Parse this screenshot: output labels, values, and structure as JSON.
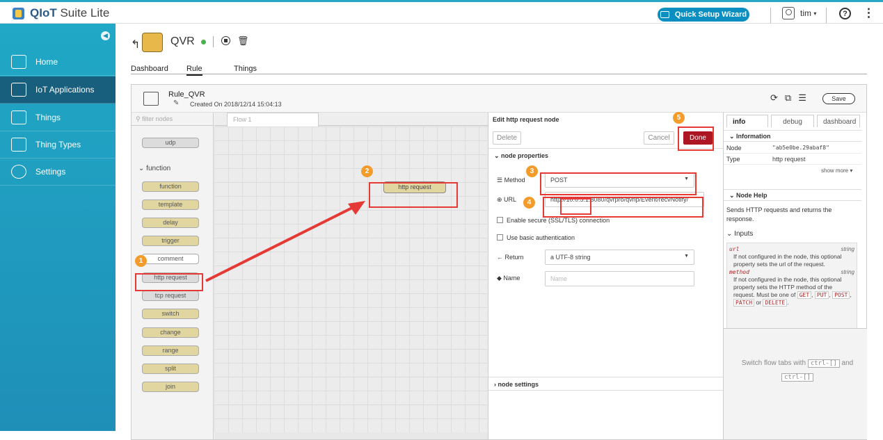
{
  "app": {
    "brand_bold": "QIoT",
    "brand_rest": " Suite Lite"
  },
  "topbar": {
    "quick_setup": "Quick Setup Wizard",
    "user": "tim",
    "user_caret": "▾",
    "help": "?",
    "more": "⋮"
  },
  "sidebar": {
    "items": [
      {
        "label": "Home",
        "icon": "home-icon"
      },
      {
        "label": "IoT Applications",
        "icon": "iot-app-icon"
      },
      {
        "label": "Things",
        "icon": "chip-icon"
      },
      {
        "label": "Thing Types",
        "icon": "grid-icon"
      },
      {
        "label": "Settings",
        "icon": "gear-icon"
      }
    ]
  },
  "header": {
    "title": "QVR"
  },
  "tabs": [
    "Dashboard",
    "Rule",
    "Things"
  ],
  "rule": {
    "name": "Rule_QVR",
    "created": "Created On 2018/12/14 15:04:13",
    "save": "Save"
  },
  "palette": {
    "filter_placeholder": "filter nodes",
    "category": "function",
    "nodes_top": [
      "udp"
    ],
    "nodes": [
      "function",
      "template",
      "delay",
      "trigger",
      "comment",
      "http request",
      "tcp request",
      "switch",
      "change",
      "range",
      "split",
      "join"
    ]
  },
  "flow": {
    "tab": "Flow 1",
    "node": "http request"
  },
  "editor": {
    "title": "Edit http request node",
    "delete": "Delete",
    "cancel": "Cancel",
    "done": "Done",
    "section_props": "node properties",
    "method_label": "Method",
    "method_value": "POST",
    "url_label": "URL",
    "url_value": "http://10.0.5.1:8080/qvrpro/qvrip/Event/recvNotify/",
    "ssl": "Enable secure (SSL/TLS) connection",
    "basic_auth": "Use basic authentication",
    "return_label": "Return",
    "return_value": "a UTF-8 string",
    "name_label": "Name",
    "name_placeholder": "Name",
    "section_settings": "node settings"
  },
  "sidepanel": {
    "tabs": [
      "info",
      "debug",
      "dashboard"
    ],
    "information": "Information",
    "node_key": "Node",
    "node_value": "\"ab5e0be.29abaf8\"",
    "type_key": "Type",
    "type_value": "http request",
    "show_more": "show more ▾",
    "node_help": "Node Help",
    "help_text": "Sends HTTP requests and returns the response.",
    "inputs": "Inputs",
    "p1_name": "url",
    "p1_type": "string",
    "p1_desc": "If not configured in the node, this optional property sets the url of the request.",
    "p2_name": "method",
    "p2_type": "string",
    "p2_desc": "If not configured in the node, this optional property sets the HTTP method of the request. Must be one of",
    "p2_opts": [
      "GET",
      "PUT",
      "POST",
      "PATCH",
      "DELETE"
    ],
    "p2_or": "or",
    "switch_text_a": "Switch flow tabs with",
    "kbd1": "ctrl-[]",
    "switch_and": "and",
    "kbd2": "ctrl-[]"
  },
  "markers": [
    "1",
    "2",
    "3",
    "4",
    "5"
  ],
  "colors": {
    "accent": "#27a9c6",
    "done": "#ad1625",
    "highlight": "#e53935",
    "marker": "#f39c2b"
  }
}
